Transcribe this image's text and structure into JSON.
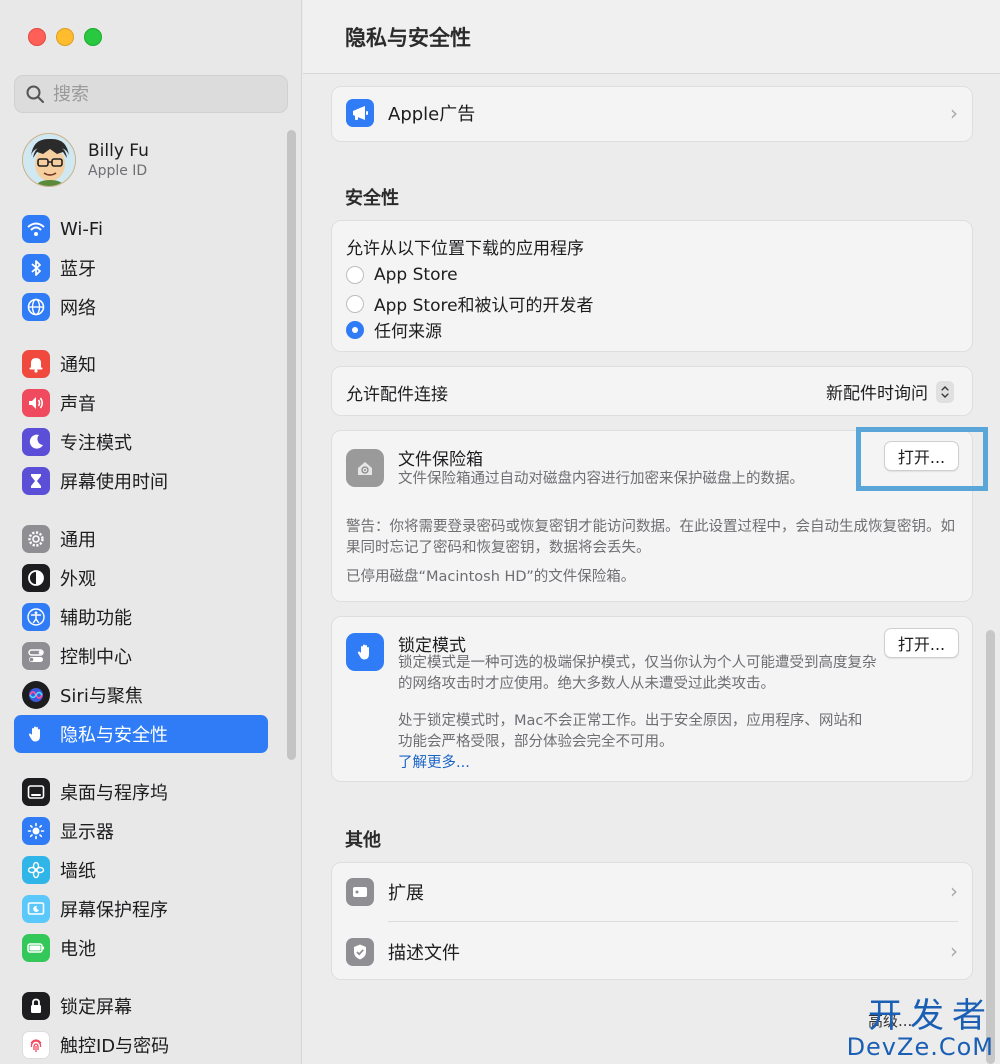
{
  "window": {
    "title": "隐私与安全性"
  },
  "sidebar": {
    "search_placeholder": "搜索",
    "account": {
      "name": "Billy Fu",
      "sub": "Apple ID"
    },
    "items": [
      {
        "label": "Wi-Fi",
        "icon": "wifi-icon",
        "color": "#2f7cf6"
      },
      {
        "label": "蓝牙",
        "icon": "bluetooth-icon",
        "color": "#2f7cf6"
      },
      {
        "label": "网络",
        "icon": "globe-icon",
        "color": "#2f7cf6"
      },
      {
        "label": "通知",
        "icon": "bell-icon",
        "color": "#f04a3e"
      },
      {
        "label": "声音",
        "icon": "speaker-icon",
        "color": "#f04a5e"
      },
      {
        "label": "专注模式",
        "icon": "moon-icon",
        "color": "#5a4fd6"
      },
      {
        "label": "屏幕使用时间",
        "icon": "hourglass-icon",
        "color": "#5a4fd6"
      },
      {
        "label": "通用",
        "icon": "gear-icon",
        "color": "#8e8e93"
      },
      {
        "label": "外观",
        "icon": "appearance-icon",
        "color": "#1d1d1f"
      },
      {
        "label": "辅助功能",
        "icon": "accessibility-icon",
        "color": "#2f7cf6"
      },
      {
        "label": "控制中心",
        "icon": "toggle-icon",
        "color": "#8e8e93"
      },
      {
        "label": "Siri与聚焦",
        "icon": "siri-icon",
        "color": "#1d1d1f"
      },
      {
        "label": "隐私与安全性",
        "icon": "hand-icon",
        "color": "#2f7cf6"
      },
      {
        "label": "桌面与程序坞",
        "icon": "dock-icon",
        "color": "#1d1d1f"
      },
      {
        "label": "显示器",
        "icon": "sun-icon",
        "color": "#2f7cf6"
      },
      {
        "label": "墙纸",
        "icon": "flower-icon",
        "color": "#2fb5e8"
      },
      {
        "label": "屏幕保护程序",
        "icon": "screensaver-icon",
        "color": "#5ac8fa"
      },
      {
        "label": "电池",
        "icon": "battery-icon",
        "color": "#34c759"
      },
      {
        "label": "锁定屏幕",
        "icon": "lock-icon",
        "color": "#1d1d1f"
      },
      {
        "label": "触控ID与密码",
        "icon": "fingerprint-icon",
        "color": "#f04a5e"
      }
    ]
  },
  "main": {
    "apple_ads": {
      "label": "Apple广告"
    },
    "security": {
      "title": "安全性",
      "download_title": "允许从以下位置下载的应用程序",
      "options": [
        "App Store",
        "App Store和被认可的开发者",
        "任何来源"
      ],
      "accessory_label": "允许配件连接",
      "accessory_value": "新配件时询问"
    },
    "filevault": {
      "title": "文件保险箱",
      "desc": "文件保险箱通过自动对磁盘内容进行加密来保护磁盘上的数据。",
      "button": "打开...",
      "warning": "警告：你将需要登录密码或恢复密钥才能访问数据。在此设置过程中，会自动生成恢复密钥。如果同时忘记了密码和恢复密钥，数据将会丢失。",
      "status": "已停用磁盘“Macintosh HD”的文件保险箱。"
    },
    "lockdown": {
      "title": "锁定模式",
      "desc1": "锁定模式是一种可选的极端保护模式，仅当你认为个人可能遭受到高度复杂的网络攻击时才应使用。绝大多数人从未遭受过此类攻击。",
      "desc2": "处于锁定模式时，Mac不会正常工作。出于安全原因，应用程序、网站和功能会严格受限，部分体验会完全不可用。",
      "link": "了解更多...",
      "button": "打开..."
    },
    "other": {
      "title": "其他",
      "items": [
        {
          "label": "扩展",
          "icon": "extension-icon"
        },
        {
          "label": "描述文件",
          "icon": "profile-icon"
        }
      ]
    },
    "advanced_button": "高级..."
  },
  "watermark": {
    "line1": "开发者",
    "line2": "DevZe.CoM"
  }
}
